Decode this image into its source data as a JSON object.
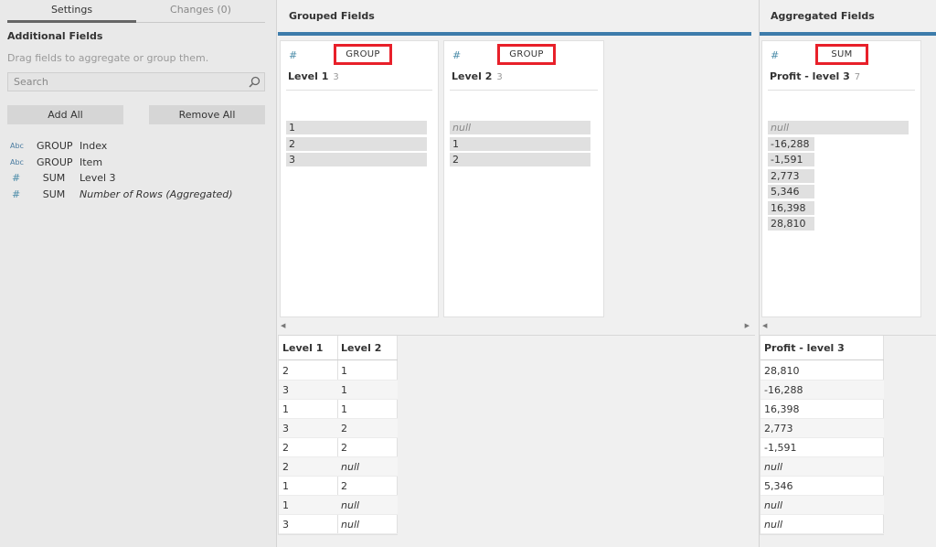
{
  "left_panel": {
    "tabs": [
      {
        "label": "Settings"
      },
      {
        "label": "Changes (0)"
      }
    ],
    "title": "Additional Fields",
    "description": "Drag fields to aggregate or group them.",
    "search_placeholder": "Search",
    "add_all_label": "Add All",
    "remove_all_label": "Remove All",
    "fields": [
      {
        "type": "Abc",
        "op": "GROUP",
        "name": "Index"
      },
      {
        "type": "Abc",
        "op": "GROUP",
        "name": "Item"
      },
      {
        "type": "#",
        "op": "SUM",
        "name": "Level 3"
      },
      {
        "type": "#",
        "op": "SUM",
        "name": "Number of Rows (Aggregated)"
      }
    ]
  },
  "grouped": {
    "title": "Grouped Fields",
    "cards": [
      {
        "icon": "#",
        "agg": "GROUP",
        "name": "Level 1",
        "count": "3",
        "values": [
          "1",
          "2",
          "3"
        ]
      },
      {
        "icon": "#",
        "agg": "GROUP",
        "name": "Level 2",
        "count": "3",
        "values": [
          "null",
          "1",
          "2"
        ]
      }
    ]
  },
  "aggregated": {
    "title": "Aggregated Fields",
    "cards": [
      {
        "icon": "#",
        "agg": "SUM",
        "name": "Profit - level 3",
        "count": "7",
        "values": [
          "null",
          "-16,288",
          "-1,591",
          "2,773",
          "5,346",
          "16,398",
          "28,810"
        ]
      }
    ]
  },
  "grouped_table": {
    "headers": [
      "Level 1",
      "Level 2"
    ],
    "rows": [
      [
        "2",
        "1"
      ],
      [
        "3",
        "1"
      ],
      [
        "1",
        "1"
      ],
      [
        "3",
        "2"
      ],
      [
        "2",
        "2"
      ],
      [
        "2",
        "null"
      ],
      [
        "1",
        "2"
      ],
      [
        "1",
        "null"
      ],
      [
        "3",
        "null"
      ]
    ]
  },
  "aggregated_table": {
    "headers": [
      "Profit - level 3"
    ],
    "rows": [
      [
        "28,810"
      ],
      [
        "-16,288"
      ],
      [
        "16,398"
      ],
      [
        "2,773"
      ],
      [
        "-1,591"
      ],
      [
        "null"
      ],
      [
        "5,346"
      ],
      [
        "null"
      ],
      [
        "null"
      ]
    ]
  },
  "colors": {
    "accent": "#3d7cab",
    "highlight": "#e8202a"
  }
}
